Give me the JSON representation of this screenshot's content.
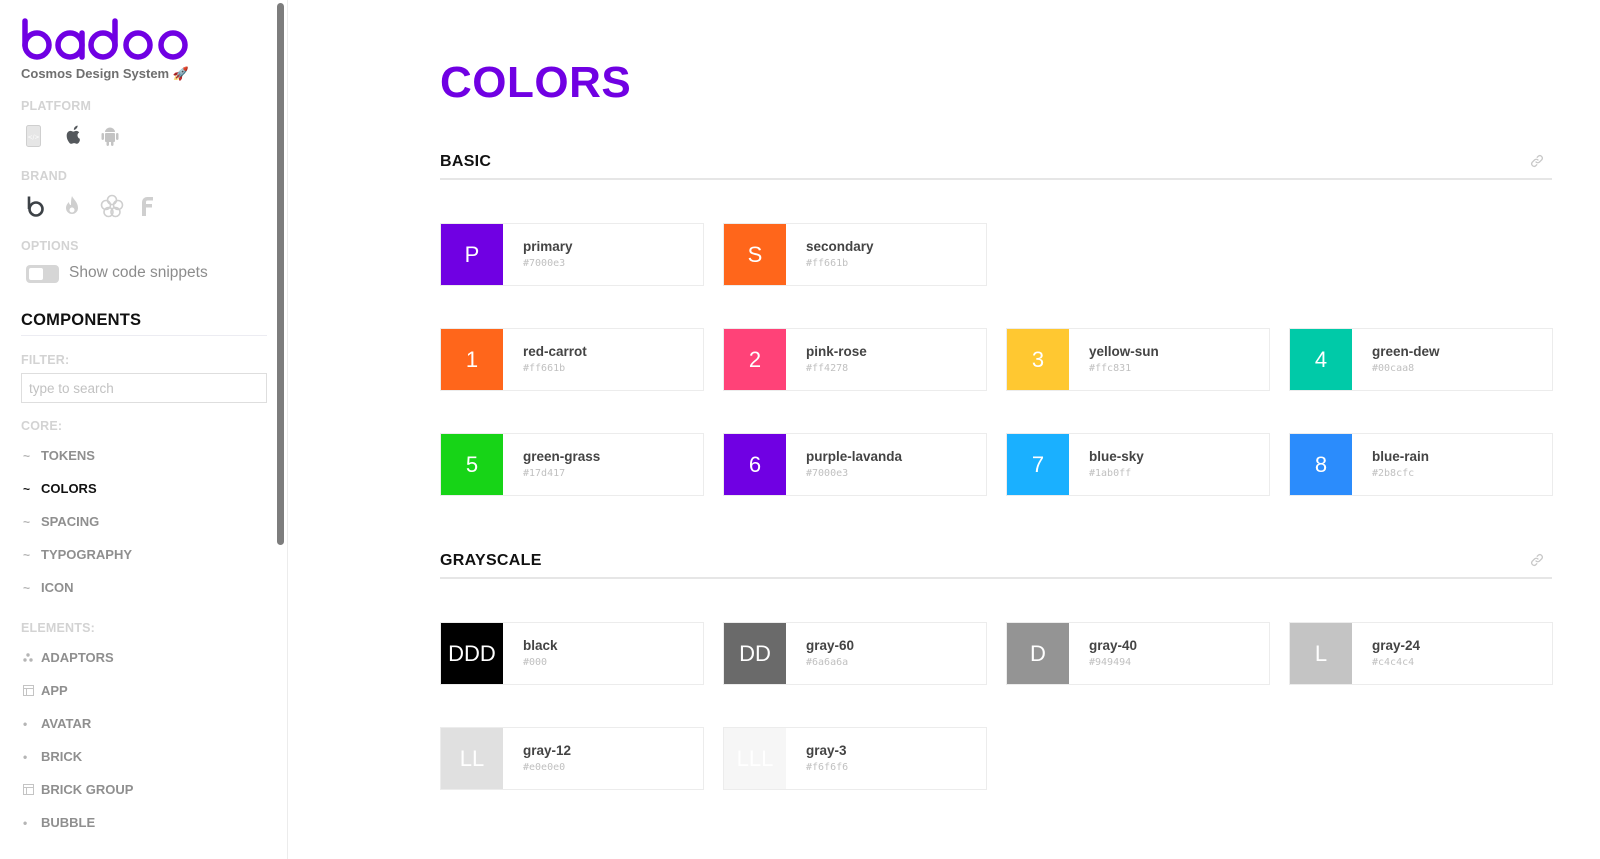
{
  "sidebar": {
    "logo_text": "badoo",
    "subtitle": "Cosmos Design System 🚀",
    "platform_label": "PLATFORM",
    "platform_icons": [
      "web-icon",
      "apple-icon",
      "android-icon"
    ],
    "brand_label": "BRAND",
    "brand_icons": [
      "badoo-brand-icon",
      "hotornot-brand-icon",
      "blendr-brand-icon",
      "fiesta-brand-icon"
    ],
    "options_label": "OPTIONS",
    "toggle_label": "Show code snippets",
    "toggle_on": false,
    "components_title": "COMPONENTS",
    "filter_label": "FILTER:",
    "filter_placeholder": "type to search",
    "filter_value": "",
    "core_label": "CORE:",
    "core_items": [
      {
        "label": "TOKENS",
        "icon": "tilde-icon",
        "active": false
      },
      {
        "label": "COLORS",
        "icon": "tilde-icon",
        "active": true
      },
      {
        "label": "SPACING",
        "icon": "tilde-icon",
        "active": false
      },
      {
        "label": "TYPOGRAPHY",
        "icon": "tilde-icon",
        "active": false
      },
      {
        "label": "ICON",
        "icon": "tilde-icon",
        "active": false
      }
    ],
    "elements_label": "ELEMENTS:",
    "element_items": [
      {
        "label": "ADAPTORS",
        "icon": "dots-icon"
      },
      {
        "label": "APP",
        "icon": "layout-icon"
      },
      {
        "label": "AVATAR",
        "icon": "dot-icon"
      },
      {
        "label": "BRICK",
        "icon": "dot-icon"
      },
      {
        "label": "BRICK GROUP",
        "icon": "layout-icon"
      },
      {
        "label": "BUBBLE",
        "icon": "dot-icon"
      }
    ]
  },
  "main": {
    "title": "COLORS",
    "sections": [
      {
        "heading": "BASIC",
        "rows": [
          [
            {
              "letter": "P",
              "name": "primary",
              "hex": "#7000e3"
            },
            {
              "letter": "S",
              "name": "secondary",
              "hex": "#ff661b"
            }
          ],
          [
            {
              "letter": "1",
              "name": "red-carrot",
              "hex": "#ff661b"
            },
            {
              "letter": "2",
              "name": "pink-rose",
              "hex": "#ff4278"
            },
            {
              "letter": "3",
              "name": "yellow-sun",
              "hex": "#ffc831"
            },
            {
              "letter": "4",
              "name": "green-dew",
              "hex": "#00caa8"
            }
          ],
          [
            {
              "letter": "5",
              "name": "green-grass",
              "hex": "#17d417"
            },
            {
              "letter": "6",
              "name": "purple-lavanda",
              "hex": "#7000e3"
            },
            {
              "letter": "7",
              "name": "blue-sky",
              "hex": "#1ab0ff"
            },
            {
              "letter": "8",
              "name": "blue-rain",
              "hex": "#2b8cfc"
            }
          ]
        ]
      },
      {
        "heading": "GRAYSCALE",
        "rows": [
          [
            {
              "letter": "DDD",
              "name": "black",
              "hex": "#000"
            },
            {
              "letter": "DD",
              "name": "gray-60",
              "hex": "#6a6a6a"
            },
            {
              "letter": "D",
              "name": "gray-40",
              "hex": "#949494"
            },
            {
              "letter": "L",
              "name": "gray-24",
              "hex": "#c4c4c4"
            }
          ],
          [
            {
              "letter": "LL",
              "name": "gray-12",
              "hex": "#e0e0e0"
            },
            {
              "letter": "LLL",
              "name": "gray-3",
              "hex": "#f6f6f6"
            }
          ]
        ]
      }
    ]
  },
  "colors": {
    "brand": "#7000e3"
  }
}
